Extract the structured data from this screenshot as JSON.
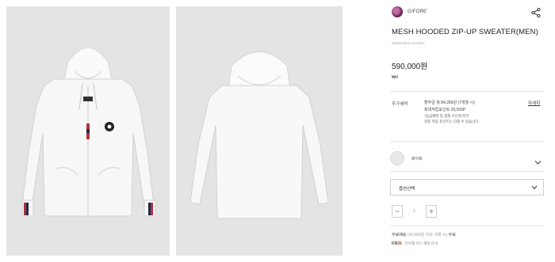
{
  "gallery": {
    "images": [
      {
        "alt": "front",
        "background": "#e4e4e4"
      },
      {
        "alt": "back",
        "background": "#e4e4e4"
      }
    ]
  },
  "brand": {
    "name": "G/FORE'"
  },
  "product": {
    "title": "MESH HOODED ZIP-UP SWEATER(MEN)",
    "sku": "GMWA9E2A431WHI",
    "price": "590,000원",
    "point": "₩8"
  },
  "benefits": {
    "label": "추가혜택",
    "lines": [
      "할부금 월 84,286원 (7개월 시)",
      "최대적립포인트 29,500P"
    ],
    "note_lines": [
      "*등급혜택 및 결제 수단에 따라",
      "최종 적립 포인트는 다를 수 있습니다."
    ],
    "more_label": "자세히"
  },
  "color": {
    "selected_name": "화이트",
    "swatch_color": "#e9e9e9"
  },
  "option": {
    "label": "옵션선택"
  },
  "quantity": {
    "value": "1"
  },
  "shipping": {
    "prefix": "무료배송",
    "threshold": "(30,000원 이상 구매 시)",
    "suffix": "무료"
  },
  "card": {
    "badge_num": "26",
    "badge_prefix": "KB",
    "text": "분야별 카드 혜택 안내"
  },
  "icons": {
    "share": "share-icon",
    "chevron": "chevron-down-icon",
    "minus": "minus-icon",
    "plus": "plus-icon"
  },
  "colors": {
    "accent_red": "#c0392b",
    "divider": "#e6e6e6",
    "border": "#cfcfcf"
  }
}
